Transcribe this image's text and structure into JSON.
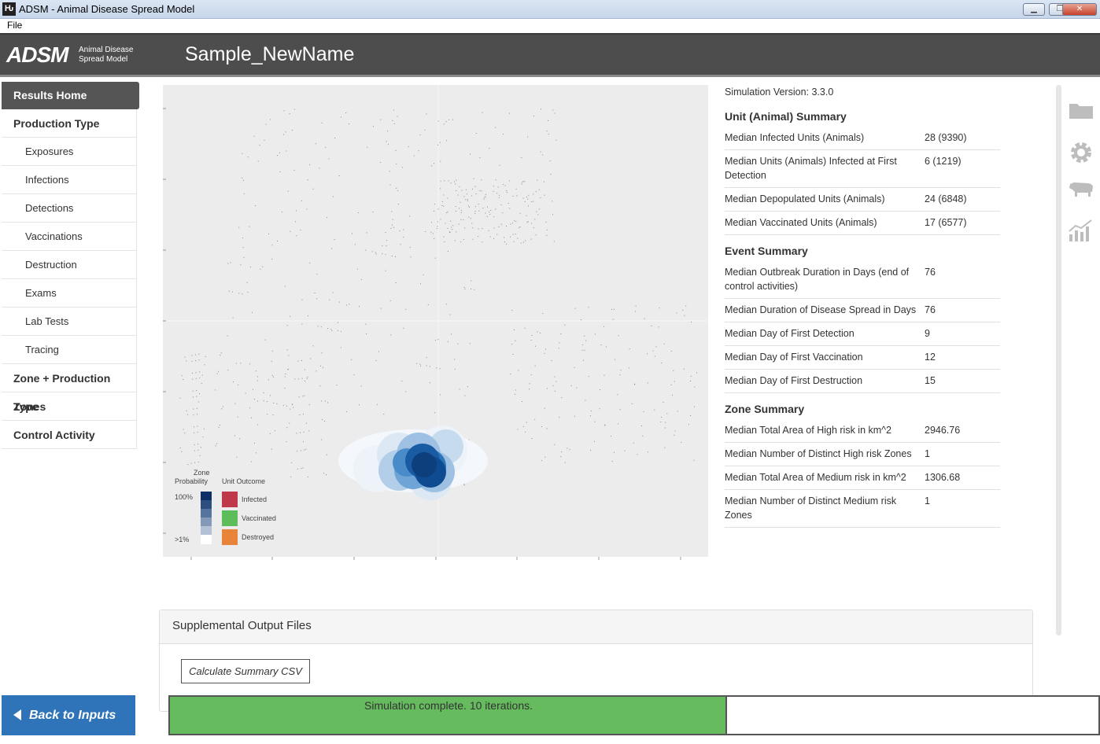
{
  "window": {
    "title": "ADSM - Animal Disease Spread Model",
    "icon_text": "Ԋ"
  },
  "menu": {
    "file": "File"
  },
  "header": {
    "logo": "ADSM",
    "logo_sub_1": "Animal Disease",
    "logo_sub_2": "Spread Model",
    "scenario_name": "Sample_NewName"
  },
  "sidebar": {
    "items": [
      {
        "label": "Results Home"
      },
      {
        "label": "Production Type"
      },
      {
        "label": "Exposures"
      },
      {
        "label": "Infections"
      },
      {
        "label": "Detections"
      },
      {
        "label": "Vaccinations"
      },
      {
        "label": "Destruction"
      },
      {
        "label": "Exams"
      },
      {
        "label": "Lab Tests"
      },
      {
        "label": "Tracing"
      },
      {
        "label": "Zone + Production Type"
      },
      {
        "label": "Zones"
      },
      {
        "label": "Control Activity"
      }
    ],
    "back": "Back to Inputs"
  },
  "legend": {
    "zone_title_1": "Zone",
    "zone_title_2": "Probability",
    "high": "100%",
    "low": ">1%",
    "outcome_title": "Unit Outcome",
    "infected": "Infected",
    "vaccinated": "Vaccinated",
    "destroyed": "Destroyed",
    "colors": {
      "infected": "#c0394a",
      "vaccinated": "#5cbd5a",
      "destroyed": "#e8843a"
    }
  },
  "summary": {
    "version": "Simulation Version: 3.3.0",
    "unit_title": "Unit (Animal) Summary",
    "unit_rows": [
      {
        "k": "Median Infected Units (Animals)",
        "v": "28 (9390)"
      },
      {
        "k": "Median Units (Animals) Infected at First Detection",
        "v": "6 (1219)"
      },
      {
        "k": "Median Depopulated Units (Animals)",
        "v": "24 (6848)"
      },
      {
        "k": "Median Vaccinated Units (Animals)",
        "v": "17 (6577)"
      }
    ],
    "event_title": "Event Summary",
    "event_rows": [
      {
        "k": "Median Outbreak Duration in Days (end of control activities)",
        "v": "76"
      },
      {
        "k": "Median Duration of Disease Spread in Days",
        "v": "76"
      },
      {
        "k": "Median Day of First Detection",
        "v": "9"
      },
      {
        "k": "Median Day of First Vaccination",
        "v": "12"
      },
      {
        "k": "Median Day of First Destruction",
        "v": "15"
      }
    ],
    "zone_title": "Zone Summary",
    "zone_rows": [
      {
        "k": "Median Total Area of High risk in km^2",
        "v": "2946.76"
      },
      {
        "k": "Median Number of Distinct High risk Zones",
        "v": "1"
      },
      {
        "k": "Median Total Area of Medium risk in km^2",
        "v": "1306.68"
      },
      {
        "k": "Median Number of Distinct Medium risk Zones",
        "v": "1"
      }
    ]
  },
  "icons": [
    "folder-icon",
    "gear-icon",
    "cow-icon",
    "chart-icon"
  ],
  "supplemental": {
    "title": "Supplemental Output Files",
    "button": "Calculate Summary CSV"
  },
  "status": {
    "text": "Simulation complete. 10 iterations.",
    "progress": 0.6
  }
}
